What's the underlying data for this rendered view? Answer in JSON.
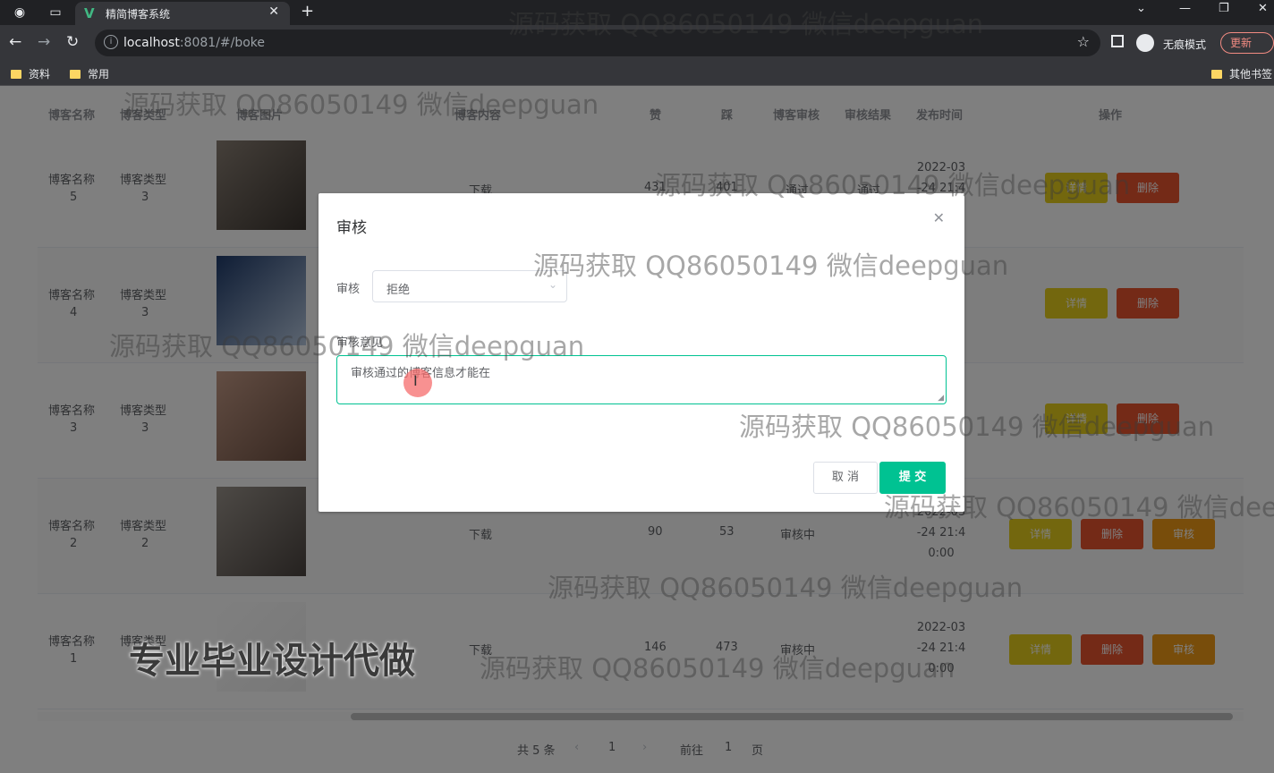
{
  "browser": {
    "tab_title": "精简博客系统",
    "url_host": "localhost",
    "url_rest": ":8081/#/boke",
    "incognito_label": "无痕模式",
    "update_label": "更新",
    "bookmarks": [
      "资料",
      "常用"
    ],
    "other_bookmarks": "其他书签"
  },
  "table": {
    "headers": [
      "博客名称",
      "博客类型",
      "博客图片",
      "博客内容",
      "赞",
      "踩",
      "博客审核",
      "审核结果",
      "发布时间",
      "操作"
    ],
    "rows": [
      {
        "name_label": "博客名称",
        "name": "5",
        "type_label": "博客类型",
        "type": "3",
        "content": "下载",
        "likes": "431",
        "dislikes": "401",
        "audit": "通过",
        "result": "通过",
        "date1": "2022-03",
        "date2": "-24 21:4",
        "date3": "0:00",
        "btn_detail": "详情",
        "btn_delete": "删除"
      },
      {
        "name_label": "博客名称",
        "name": "4",
        "type_label": "博客类型",
        "type": "3",
        "btn_detail": "详情",
        "btn_delete": "删除"
      },
      {
        "name_label": "博客名称",
        "name": "3",
        "type_label": "博客类型",
        "type": "3",
        "btn_detail": "详情",
        "btn_delete": "删除"
      },
      {
        "name_label": "博客名称",
        "name": "2",
        "type_label": "博客类型",
        "type": "2",
        "content": "下载",
        "likes": "90",
        "dislikes": "53",
        "audit": "审核中",
        "date1": "2022-03",
        "date2": "-24 21:4",
        "date3": "0:00",
        "btn_detail": "详情",
        "btn_delete": "删除",
        "btn_audit": "审核"
      },
      {
        "name_label": "博客名称",
        "name": "1",
        "type_label": "博客类型",
        "content": "下载",
        "likes": "146",
        "dislikes": "473",
        "audit": "审核中",
        "date1": "2022-03",
        "date2": "-24 21:4",
        "date3": "0:00",
        "btn_detail": "详情",
        "btn_delete": "删除",
        "btn_audit": "审核"
      }
    ]
  },
  "pagination": {
    "total": "共 5 条",
    "current": "1",
    "goto_label": "前往",
    "goto_value": "1",
    "page_suffix": "页"
  },
  "dialog": {
    "title": "审核",
    "audit_label": "审核",
    "audit_value": "拒绝",
    "reason_label": "审核意见",
    "reason_value": "审核通过的博客信息才能在",
    "cancel": "取 消",
    "submit": "提 交"
  },
  "watermarks": {
    "text": "源码获取 QQ86050149 微信deepguan",
    "text_cut": "源码获取 QQ86050149 微信dee",
    "banner": "专业毕业设计代做"
  }
}
